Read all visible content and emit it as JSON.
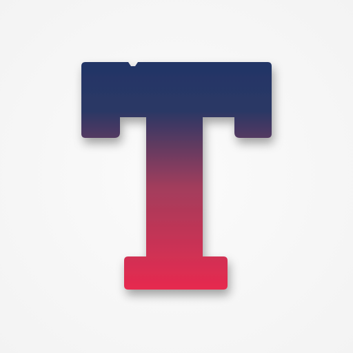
{
  "logo": {
    "letter": "T",
    "icon_name": "letter-t-logo-icon",
    "colors": {
      "background": "#f6f6f6",
      "gradient_top": "#223566",
      "gradient_mid": "#a23d5c",
      "gradient_bottom": "#e72a4f"
    }
  }
}
